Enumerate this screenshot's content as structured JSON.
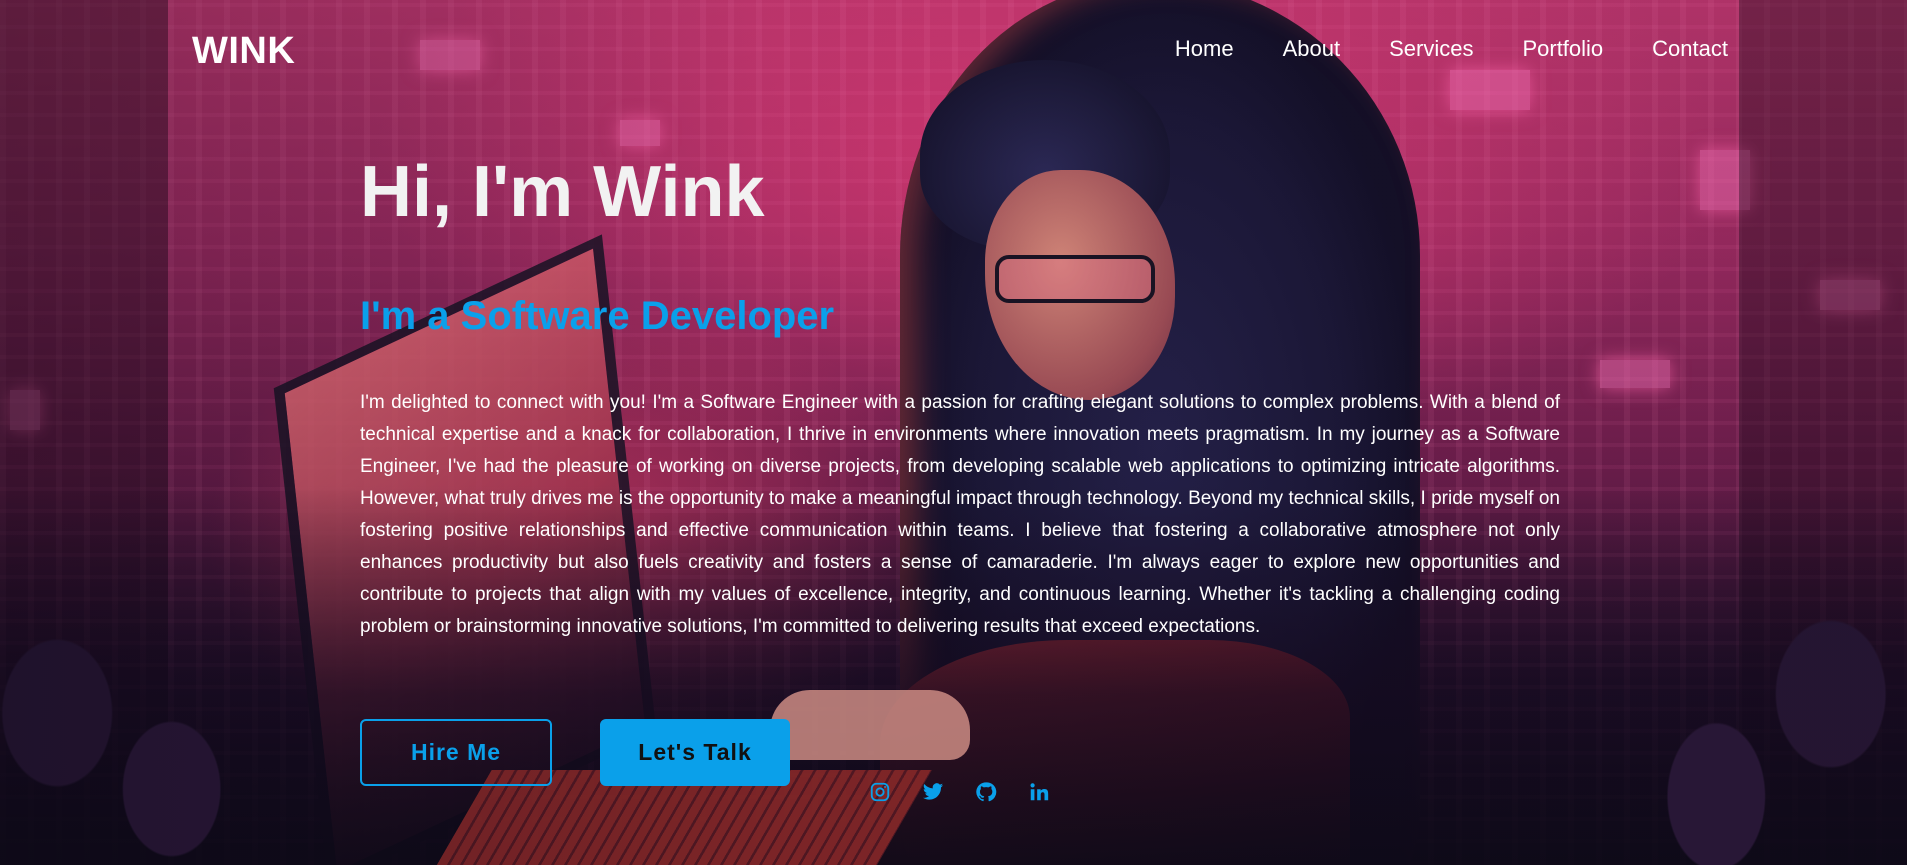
{
  "header": {
    "logo": "WINK",
    "nav": [
      "Home",
      "About",
      "Services",
      "Portfolio",
      "Contact"
    ]
  },
  "hero": {
    "title": "Hi, I'm Wink",
    "subtitle": "I'm a Software Developer",
    "bio": "I'm delighted to connect with you! I'm a Software Engineer with a passion for crafting elegant solutions to complex problems. With a blend of technical expertise and a knack for collaboration, I thrive in environments where innovation meets pragmatism. In my journey as a Software Engineer, I've had the pleasure of working on diverse projects, from developing scalable web applications to optimizing intricate algorithms. However, what truly drives me is the opportunity to make a meaningful impact through technology. Beyond my technical skills, I pride myself on fostering positive relationships and effective communication within teams. I believe that fostering a collaborative atmosphere not only enhances productivity but also fuels creativity and fosters a sense of camaraderie. I'm always eager to explore new opportunities and contribute to projects that align with my values of excellence, integrity, and continuous learning. Whether it's tackling a challenging coding problem or brainstorming innovative solutions, I'm committed to delivering results that exceed expectations."
  },
  "buttons": {
    "hire": "Hire Me",
    "talk": "Let's Talk"
  },
  "socials": [
    "instagram-icon",
    "twitter-icon",
    "github-icon",
    "linkedin-icon"
  ],
  "colors": {
    "accent": "#0aa0ea",
    "text": "#ffffff",
    "heading": "#f2f2f2"
  }
}
